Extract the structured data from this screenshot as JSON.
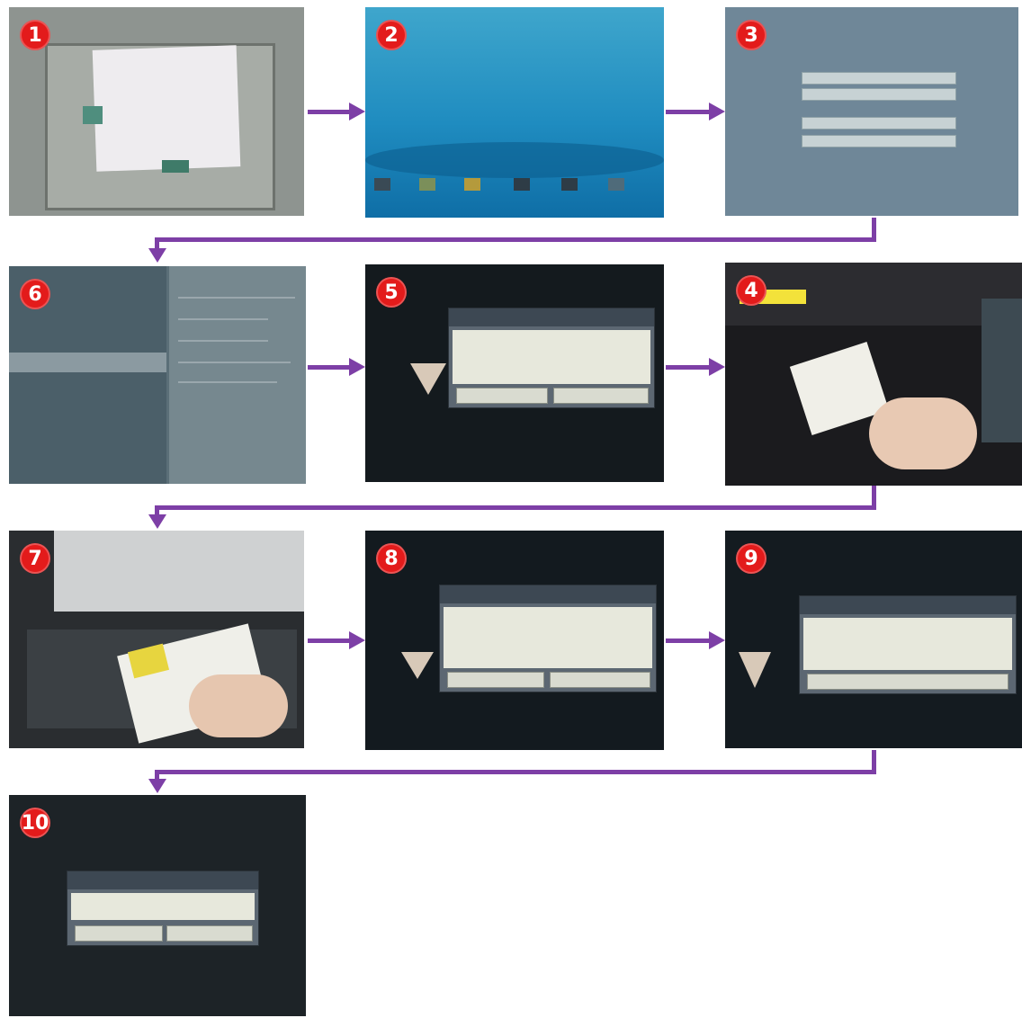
{
  "steps": [
    {
      "number": "1",
      "image": "printer paper tray loaded with paper"
    },
    {
      "number": "2",
      "image": "printer control panel home screen"
    },
    {
      "number": "3",
      "image": "login screen with ID and password fields"
    },
    {
      "number": "4",
      "image": "hand placing document on printer"
    },
    {
      "number": "5",
      "image": "Setting Standard Time dialog"
    },
    {
      "number": "6",
      "image": "machine settings menu"
    },
    {
      "number": "7",
      "image": "hand placing document on scanner glass"
    },
    {
      "number": "8",
      "image": "Setting Standard Time dialog"
    },
    {
      "number": "9",
      "image": "Setting Standard Time processing dialog"
    },
    {
      "number": "10",
      "image": "Color Test Chart dialog"
    }
  ],
  "colors": {
    "arrow": "#7d3fa6",
    "badge": "#e31b1b"
  }
}
